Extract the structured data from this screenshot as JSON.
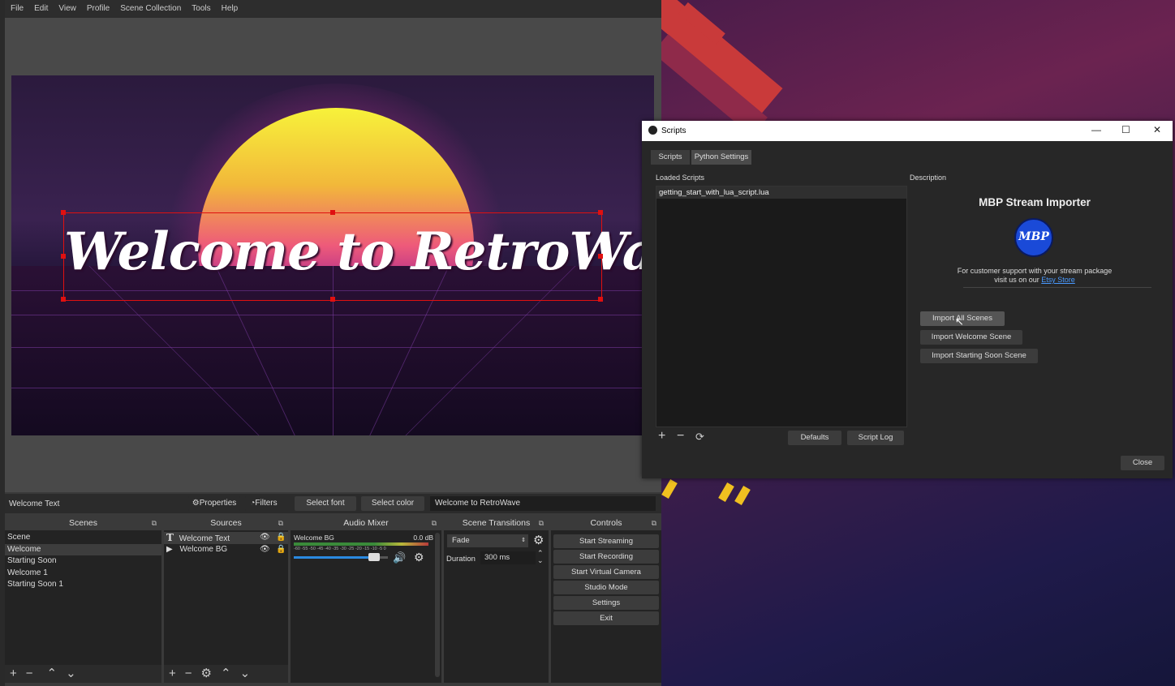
{
  "menu": [
    "File",
    "Edit",
    "View",
    "Profile",
    "Scene Collection",
    "Tools",
    "Help"
  ],
  "preview": {
    "overlay_text": "Welcome to RetroWave"
  },
  "source_toolbar": {
    "source_name": "Welcome Text",
    "properties": "Properties",
    "filters": "Filters",
    "select_font": "Select font",
    "select_color": "Select color",
    "text_value": "Welcome to RetroWave"
  },
  "scenes": {
    "title": "Scenes",
    "items": [
      "Scene",
      "Welcome",
      "Starting Soon",
      "Welcome 1",
      "Starting Soon 1"
    ],
    "selected": "Welcome"
  },
  "sources": {
    "title": "Sources",
    "items": [
      {
        "name": "Welcome Text",
        "icon": "text-icon"
      },
      {
        "name": "Welcome BG",
        "icon": "play-icon"
      }
    ]
  },
  "audio_mixer": {
    "title": "Audio Mixer",
    "channel": "Welcome BG",
    "level": "0.0 dB",
    "scale": "-60 -55 -50 -45 -40 -35 -30 -25 -20 -15 -10 -5 0",
    "volume_fraction": 0.85
  },
  "scene_transitions": {
    "title": "Scene Transitions",
    "transition": "Fade",
    "duration_label": "Duration",
    "duration_value": "300 ms"
  },
  "controls": {
    "title": "Controls",
    "buttons": [
      "Start Streaming",
      "Start Recording",
      "Start Virtual Camera",
      "Studio Mode",
      "Settings",
      "Exit"
    ]
  },
  "scripts_dialog": {
    "title": "Scripts",
    "tabs": [
      "Scripts",
      "Python Settings"
    ],
    "loaded_scripts_label": "Loaded Scripts",
    "scripts": [
      "getting_start_with_lua_script.lua"
    ],
    "defaults": "Defaults",
    "script_log": "Script Log",
    "description_label": "Description",
    "desc_title": "MBP Stream Importer",
    "logo_text": "MBP",
    "support_line1": "For customer support with your stream package",
    "support_line2": "visit us on our",
    "support_link": "Etsy Store",
    "import_buttons": [
      "Import All Scenes",
      "Import Welcome Scene",
      "Import Starting Soon Scene"
    ],
    "close": "Close"
  }
}
